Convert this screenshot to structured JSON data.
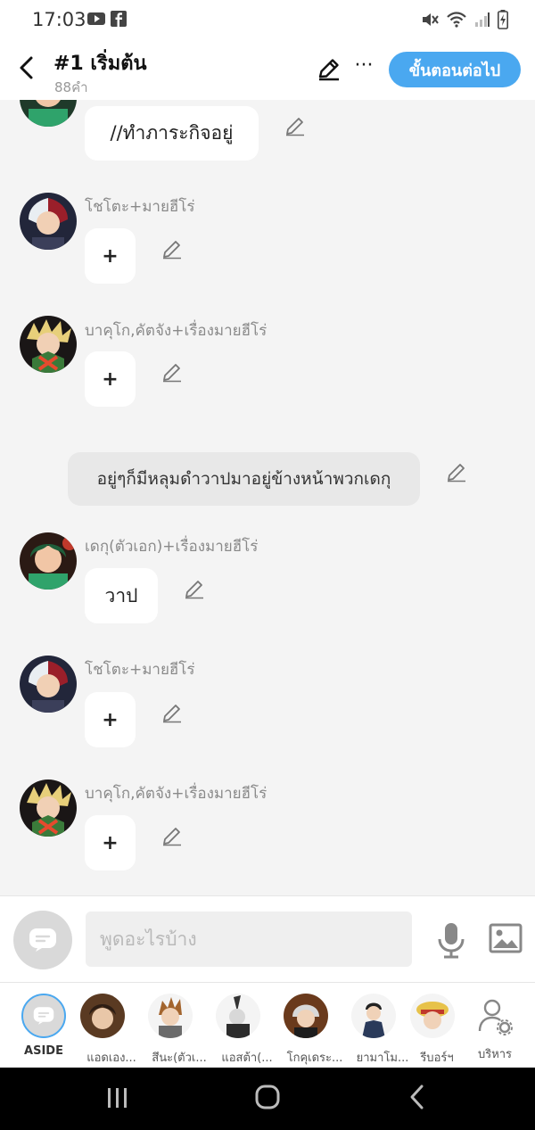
{
  "status_bar": {
    "time": "17:03"
  },
  "header": {
    "title": "#1 เริ่มต้น",
    "word_count": "88คำ",
    "next_button": "ขั้นตอนต่อไป",
    "more_label": "···"
  },
  "messages": [
    {
      "type": "dialogue",
      "text": "//ทำภาระกิจอยู่"
    },
    {
      "type": "character",
      "name": "โชโตะ+มายฮีโร่",
      "text": "+"
    },
    {
      "type": "character",
      "name": "บาคุโก,คัตจัง+เรื่องมายฮีโร่",
      "text": "+"
    },
    {
      "type": "narration",
      "text": "อยู่ๆก็มีหลุมดำวาปมาอยู่ข้างหน้าพวกเดกุ"
    },
    {
      "type": "character",
      "name": "เดกุ(ตัวเอก)+เรื่องมายฮีโร่",
      "text": "วาป"
    },
    {
      "type": "character",
      "name": "โชโตะ+มายฮีโร่",
      "text": "+"
    },
    {
      "type": "character",
      "name": "บาคุโก,คัตจัง+เรื่องมายฮีโร่",
      "text": "+"
    }
  ],
  "composer": {
    "placeholder": "พูดอะไรบ้าง"
  },
  "characters": [
    {
      "label": "ASIDE"
    },
    {
      "label": "แอดเอง..."
    },
    {
      "label": "สึนะ(ตัวเ..."
    },
    {
      "label": "แอสต้า(..."
    },
    {
      "label": "โกคุเดระ..."
    },
    {
      "label": "ยามาโม..."
    },
    {
      "label": "รีบอร์ฯ"
    },
    {
      "label": "บริหาร"
    }
  ],
  "colors": {
    "accent": "#4aa8f0",
    "background": "#f4f4f4",
    "bubble": "#ffffff",
    "narration": "#e8e8e8"
  }
}
